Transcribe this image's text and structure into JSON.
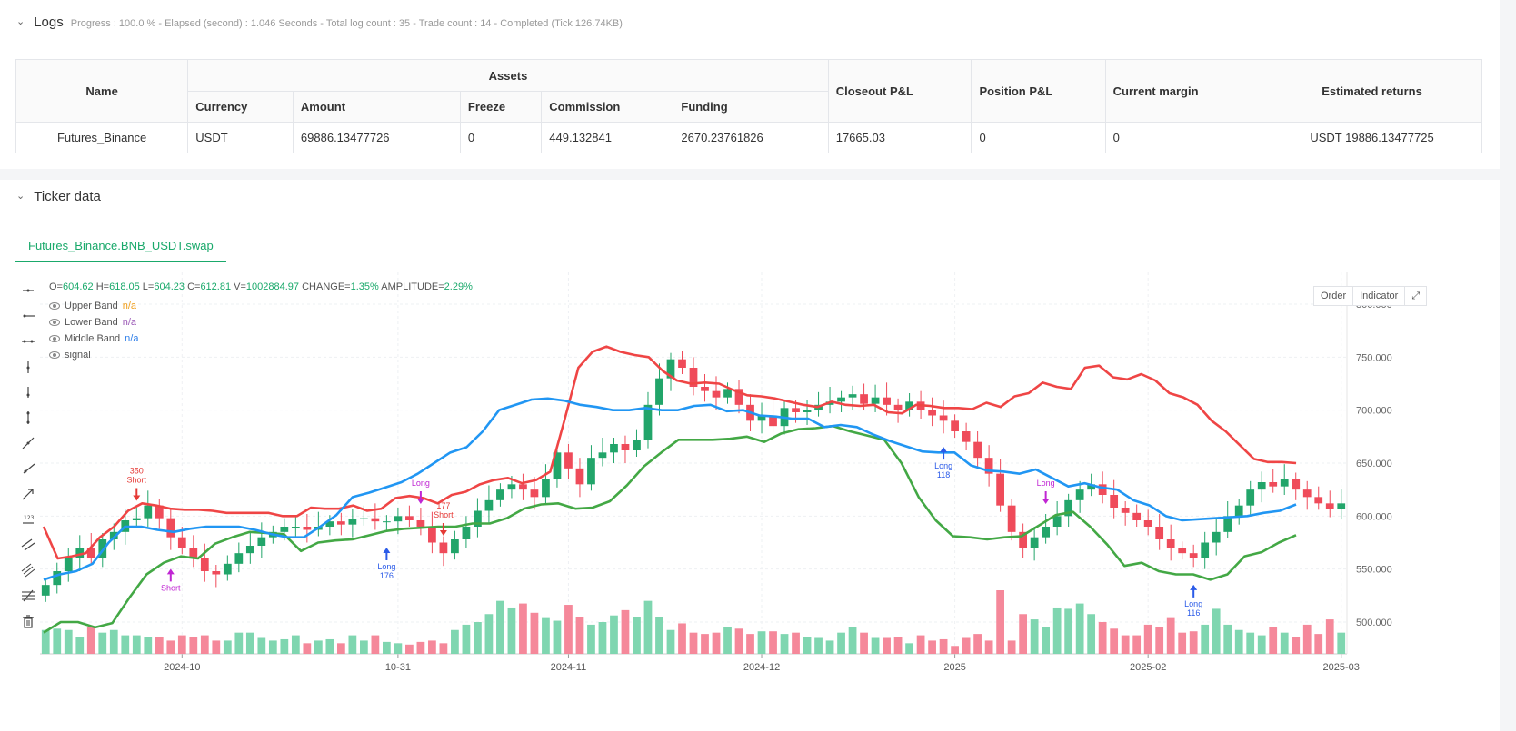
{
  "logs": {
    "title": "Logs",
    "summary": "Progress : 100.0 % - Elapsed (second) : 1.046 Seconds - Total log count : 35 - Trade count : 14 - Completed (Tick 126.74KB)"
  },
  "assets_table": {
    "group_header": "Assets",
    "headers": {
      "name": "Name",
      "currency": "Currency",
      "amount": "Amount",
      "freeze": "Freeze",
      "commission": "Commission",
      "funding": "Funding",
      "closeout": "Closeout P&L",
      "position": "Position P&L",
      "margin": "Current margin",
      "returns": "Estimated returns"
    },
    "row": {
      "name": "Futures_Binance",
      "currency": "USDT",
      "amount": "69886.13477726",
      "freeze": "0",
      "commission": "449.132841",
      "funding": "2670.23761826",
      "closeout": "17665.03",
      "position": "0",
      "margin": "0",
      "returns": "USDT 19886.13477725"
    }
  },
  "ticker": {
    "title": "Ticker data",
    "tab": "Futures_Binance.BNB_USDT.swap",
    "ohlc": {
      "o_label": "O=",
      "o": "604.62",
      "h_label": "H=",
      "h": "618.05",
      "l_label": "L=",
      "l": "604.23",
      "c_label": "C=",
      "c": "612.81",
      "v_label": "V=",
      "v": "1002884.97",
      "change_label": "CHANGE=",
      "change": "1.35%",
      "amp_label": "AMPLITUDE=",
      "amp": "2.29%"
    },
    "legend": [
      {
        "name": "Upper Band",
        "value": "n/a",
        "color": "#f0a020"
      },
      {
        "name": "Lower Band",
        "value": "n/a",
        "color": "#9b59b6"
      },
      {
        "name": "Middle Band",
        "value": "n/a",
        "color": "#2b7de9"
      },
      {
        "name": "signal",
        "value": "",
        "color": "#888888"
      }
    ],
    "buttons": {
      "order": "Order",
      "indicator": "Indicator"
    }
  },
  "toolbar_icons": [
    "horizontal-line-icon",
    "horizontal-ray-icon",
    "extended-line-icon",
    "vertical-ray-icon",
    "vertical-segment-icon",
    "vertical-line-icon",
    "trend-line-icon",
    "ray-icon",
    "arrow-line-icon",
    "label-icon",
    "parallel-channel-icon",
    "pitchfork-icon",
    "fib-retracement-icon",
    "trash-icon"
  ],
  "chart_data": {
    "type": "candlestick",
    "y_ticks": [
      "800.000",
      "750.000",
      "700.000",
      "650.000",
      "600.000",
      "550.000",
      "500.000"
    ],
    "ylim": [
      470,
      830
    ],
    "x_ticks": [
      {
        "label": "2024-10",
        "i": 12
      },
      {
        "label": "10-31",
        "i": 31
      },
      {
        "label": "2024-11",
        "i": 46
      },
      {
        "label": "2024-12",
        "i": 63
      },
      {
        "label": "2025",
        "i": 80
      },
      {
        "label": "2025-02",
        "i": 97
      },
      {
        "label": "2025-03",
        "i": 114
      }
    ],
    "closes": [
      535,
      548,
      560,
      570,
      560,
      578,
      585,
      596,
      598,
      610,
      598,
      580,
      570,
      560,
      548,
      545,
      555,
      565,
      572,
      580,
      585,
      590,
      590,
      587,
      590,
      595,
      592,
      597,
      598,
      595,
      595,
      600,
      596,
      590,
      575,
      565,
      578,
      590,
      605,
      615,
      625,
      630,
      625,
      618,
      635,
      660,
      645,
      630,
      655,
      660,
      668,
      662,
      672,
      705,
      730,
      748,
      740,
      722,
      718,
      712,
      720,
      705,
      690,
      695,
      685,
      702,
      698,
      700,
      705,
      708,
      712,
      715,
      706,
      712,
      705,
      700,
      708,
      700,
      695,
      690,
      680,
      670,
      655,
      640,
      610,
      585,
      570,
      580,
      590,
      600,
      615,
      625,
      630,
      620,
      608,
      603,
      596,
      590,
      578,
      570,
      565,
      560,
      575,
      585,
      600,
      610,
      625,
      632,
      628,
      635,
      625,
      618,
      612,
      607,
      612
    ],
    "volumes": [
      18,
      19,
      18,
      13,
      20,
      16,
      18,
      14,
      14,
      13,
      13,
      10,
      14,
      13,
      14,
      10,
      10,
      16,
      16,
      12,
      10,
      11,
      14,
      8,
      10,
      11,
      8,
      14,
      10,
      14,
      9,
      8,
      7,
      9,
      10,
      8,
      18,
      22,
      24,
      30,
      40,
      35,
      38,
      31,
      27,
      25,
      37,
      28,
      22,
      24,
      29,
      33,
      28,
      40,
      28,
      18,
      23,
      16,
      15,
      16,
      20,
      19,
      15,
      17,
      17,
      15,
      16,
      13,
      12,
      10,
      16,
      20,
      16,
      12,
      12,
      13,
      8,
      14,
      10,
      11,
      6,
      12,
      15,
      10,
      48,
      10,
      30,
      26,
      20,
      35,
      34,
      38,
      30,
      24,
      19,
      14,
      14,
      22,
      20,
      27,
      16,
      17,
      22,
      34,
      22,
      18,
      16,
      14,
      20,
      16,
      13,
      22,
      15,
      26,
      16
    ],
    "upper_band": [
      590,
      560,
      562,
      565,
      580,
      590,
      605,
      612,
      610,
      607,
      606,
      606,
      605,
      603,
      603,
      603,
      603,
      600,
      600,
      608,
      607,
      607,
      610,
      605,
      607,
      617,
      619,
      617,
      612,
      620,
      623,
      630,
      634,
      636,
      631,
      634,
      642,
      690,
      740,
      755,
      760,
      755,
      752,
      750,
      737,
      728,
      725,
      726,
      725,
      719,
      714,
      713,
      711,
      708,
      705,
      703,
      708,
      705,
      704,
      705,
      698,
      697,
      705,
      704,
      702,
      702,
      701,
      707,
      703,
      713,
      716,
      726,
      722,
      720,
      740,
      742,
      731,
      729,
      734,
      728,
      716,
      712,
      705,
      690,
      680,
      667,
      654,
      651,
      651,
      650
    ],
    "middle_band": [
      540,
      545,
      548,
      555,
      575,
      590,
      590,
      587,
      585,
      588,
      590,
      590,
      590,
      587,
      583,
      580,
      580,
      590,
      601,
      618,
      622,
      627,
      632,
      640,
      650,
      660,
      665,
      680,
      700,
      705,
      710,
      711,
      709,
      705,
      703,
      700,
      700,
      702,
      700,
      700,
      704,
      705,
      699,
      700,
      695,
      694,
      692,
      692,
      684,
      686,
      684,
      677,
      671,
      666,
      661,
      660,
      660,
      648,
      643,
      642,
      640,
      644,
      636,
      628,
      631,
      627,
      625,
      615,
      610,
      600,
      596,
      597,
      598,
      599,
      600,
      603,
      605,
      611
    ],
    "lower_band": [
      490,
      500,
      500,
      495,
      499,
      523,
      545,
      556,
      562,
      560,
      574,
      580,
      585,
      584,
      583,
      567,
      575,
      577,
      578,
      582,
      586,
      588,
      589,
      590,
      590,
      593,
      593,
      598,
      607,
      611,
      612,
      607,
      608,
      614,
      629,
      647,
      660,
      672,
      672,
      672,
      673,
      675,
      670,
      678,
      682,
      683,
      685,
      680,
      676,
      672,
      650,
      618,
      596,
      581,
      580,
      578,
      580,
      581,
      591,
      601,
      604,
      590,
      573,
      553,
      556,
      548,
      545,
      545,
      540,
      545,
      562,
      566,
      575,
      582
    ],
    "annotations": [
      {
        "text": "350",
        "sub": "Short",
        "i": 8,
        "type": "short"
      },
      {
        "text": "Short",
        "i": 11,
        "type": "short-low"
      },
      {
        "text": "177",
        "sub": "Short",
        "i": 35,
        "type": "short"
      },
      {
        "text": "Long",
        "i": 33,
        "type": "long-top"
      },
      {
        "text": "Long",
        "sub": "176",
        "i": 30,
        "type": "long"
      },
      {
        "text": "Long",
        "sub": "118",
        "i": 79,
        "type": "long"
      },
      {
        "text": "Long",
        "i": 88,
        "type": "long-top"
      },
      {
        "text": "Long",
        "sub": "116",
        "i": 101,
        "type": "long"
      }
    ]
  }
}
